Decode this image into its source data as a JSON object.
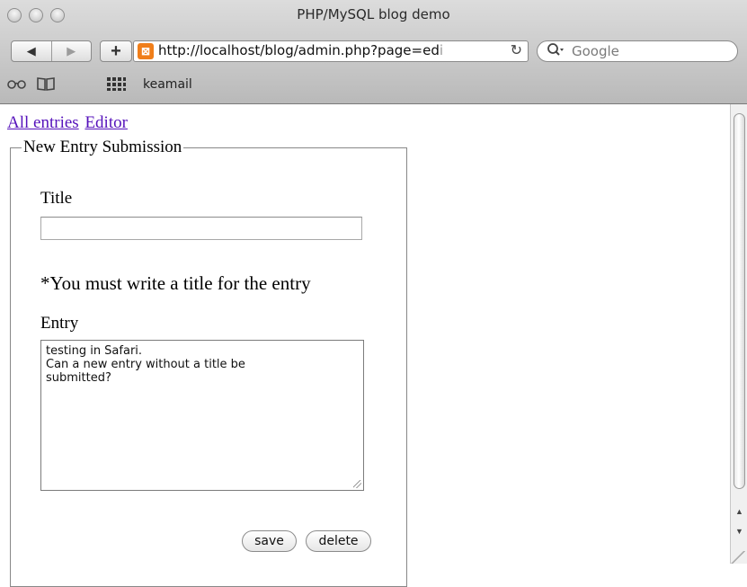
{
  "window": {
    "title": "PHP/MySQL blog demo"
  },
  "toolbar": {
    "back_icon": "◀",
    "forward_icon": "▶",
    "add_icon": "+",
    "favicon_label": "⊠",
    "url": "http://localhost/blog/admin.php?page=ed",
    "url_fade": "i",
    "reload_icon": "↻",
    "search_placeholder": "Google",
    "search_icon": "🔍"
  },
  "bookmarks": {
    "reading_icon": "ᨐ",
    "book_icon": "🕮",
    "grid_icon": "▦",
    "items": [
      "keamail"
    ]
  },
  "nav": {
    "links": [
      "All entries",
      "Editor"
    ]
  },
  "form": {
    "legend": "New Entry Submission",
    "title_label": "Title",
    "title_value": "",
    "error_message": "*You must write a title for the entry",
    "entry_label": "Entry",
    "entry_text": "testing in Safari.\nCan a new entry without a title be\nsubmitted?",
    "save_label": "save",
    "delete_label": "delete"
  },
  "colors": {
    "link": "#5511bb",
    "favicon": "#f07e1a"
  }
}
